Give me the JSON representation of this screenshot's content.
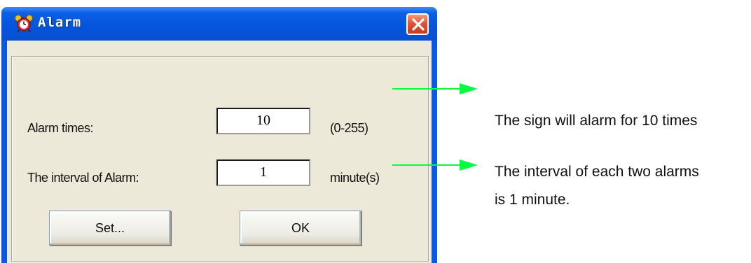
{
  "window": {
    "title": "Alarm",
    "close_symbol": "×"
  },
  "form": {
    "alarm_times_label": "Alarm times:",
    "alarm_times_value": "10",
    "alarm_times_range": "(0-255)",
    "interval_label": "The interval of Alarm:",
    "interval_value": "1",
    "interval_unit": "minute(s)"
  },
  "buttons": {
    "set_label": "Set...",
    "ok_label": "OK"
  },
  "annotations": {
    "alarm_note": "The sign will alarm for 10 times",
    "interval_note_line1": "The interval of each two alarms",
    "interval_note_line2": "is 1 minute."
  },
  "icons": {
    "window_icon": "alarm-clock-icon",
    "close": "close-icon"
  },
  "colors": {
    "titlebar": "#0454dc",
    "dialog_bg": "#ece9d8",
    "close_button": "#e2553a",
    "arrow": "#00ff40"
  }
}
